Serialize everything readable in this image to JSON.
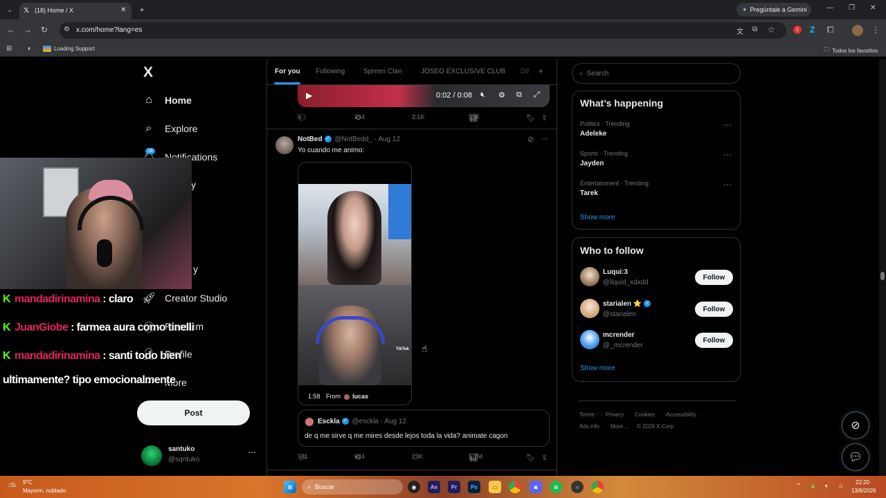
{
  "browser": {
    "tab_title": "(18) Home / X",
    "gemini_label": "Pregúntale a Gemini",
    "url": "x.com/home?lang=es",
    "bookmark_loading": "Loading Support",
    "bookmark_all": "Todos los favoritos",
    "extension_badge": "1"
  },
  "sidebar": {
    "logo": "X",
    "items": [
      {
        "label": "Home",
        "icon": "home-icon"
      },
      {
        "label": "Explore",
        "icon": "search-icon"
      },
      {
        "label": "Notifications",
        "icon": "bell-icon",
        "badge": "18"
      },
      {
        "label": "Creator Studio",
        "icon": "rocket-icon"
      },
      {
        "label": "Premium",
        "icon": "x-circle-icon"
      },
      {
        "label": "Profile",
        "icon": "person-icon"
      },
      {
        "label": "More",
        "icon": "more-circle-icon"
      }
    ],
    "partial_labels": [
      "y",
      "y"
    ],
    "post_label": "Post",
    "account": {
      "name": "santuko",
      "handle": "@sqntuko"
    }
  },
  "stream_chat": [
    {
      "user": "mandadirinamina",
      "message": " : claro"
    },
    {
      "user": "JuanGiobe",
      "message": " : farmea aura como tinelli"
    },
    {
      "user": "mandadirinamina",
      "message": " : santi todo bien"
    },
    {
      "user": "",
      "message": "ultimamente? tipo emocionalmente"
    }
  ],
  "feed": {
    "tabs": [
      "For you",
      "Following",
      "Spreen Clan",
      "JOSEO EXCLUSIVE CLUB",
      "Dif"
    ],
    "active_tab": 0,
    "top_video": {
      "time": "0:02 / 0:08"
    },
    "top_post_stats": {
      "replies": "6",
      "reposts": "234",
      "likes": "2.1K",
      "views": "38K"
    },
    "post": {
      "author": "NotBed",
      "handle": "@NotBedd_",
      "date": "· Aug 12",
      "text": "Yo cuando me animo:",
      "video_duration": "1:58",
      "video_from_label": "From",
      "video_from_user": "lucas",
      "tiktok_label": "TikTok",
      "quote": {
        "author": "Esckla",
        "handle": "@esckla",
        "date": "· Aug 12",
        "text": "de q me sirve q me mires desde lejos toda la vida? animate cagon"
      },
      "stats": {
        "replies": "181",
        "reposts": "924",
        "likes": "23K",
        "views": "1.7M"
      }
    }
  },
  "right": {
    "search_placeholder": "Search",
    "whats_happening": {
      "title": "What’s happening",
      "trends": [
        {
          "meta": "Politics · Trending",
          "name": "Adeleke"
        },
        {
          "meta": "Sports · Trending",
          "name": "Jayden"
        },
        {
          "meta": "Entertainment · Trending",
          "name": "Tarek"
        }
      ],
      "show_more": "Show more"
    },
    "who_to_follow": {
      "title": "Who to follow",
      "users": [
        {
          "name": "Luqui:3",
          "handle": "@liquid_xdxdd",
          "verified": false
        },
        {
          "name": "starialen ⭐",
          "handle": "@starialen",
          "verified": true
        },
        {
          "name": "mcrender",
          "handle": "@_mcrender",
          "verified": false
        }
      ],
      "follow_label": "Follow",
      "show_more": "Show more"
    },
    "footer": [
      "Terms",
      "Privacy",
      "Cookies",
      "Accessibility",
      "Ads info",
      "More ...",
      "© 2026 X Corp."
    ]
  },
  "taskbar": {
    "temp": "9°C",
    "weather": "Mayorm. nublado",
    "search_placeholder": "Buscar",
    "time": "22:20",
    "date": "13/8/2026"
  },
  "colors": {
    "accent": "#1d9bf0",
    "kick_green": "#53fc18",
    "chat_user": "#e0245e"
  }
}
